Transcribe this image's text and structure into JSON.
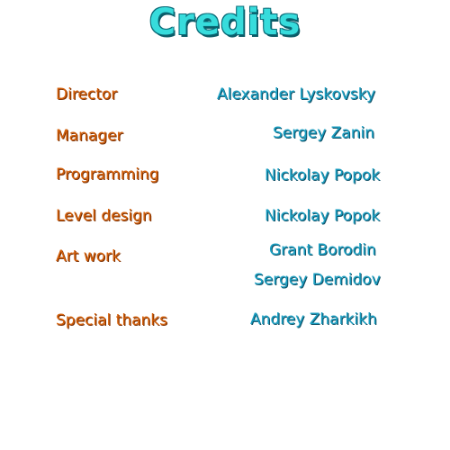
{
  "title": "Credits",
  "credits": [
    {
      "role": "Director",
      "names": [
        "Alexander Lyskovsky"
      ]
    },
    {
      "role": "Manager",
      "names": [
        "Sergey Zanin"
      ]
    },
    {
      "role": "Programming",
      "names": [
        "Nickolay Popok"
      ]
    },
    {
      "role": "Level design",
      "names": [
        "Nickolay Popok"
      ]
    },
    {
      "role": "Art work",
      "names": [
        "Grant Borodin",
        "Sergey Demidov"
      ]
    },
    {
      "role": "Special thanks",
      "names": [
        "Andrey Zharkikh"
      ]
    }
  ],
  "colors": {
    "title": "#37dcdc",
    "role": "#d4600a",
    "name": "#1a9fc2"
  }
}
